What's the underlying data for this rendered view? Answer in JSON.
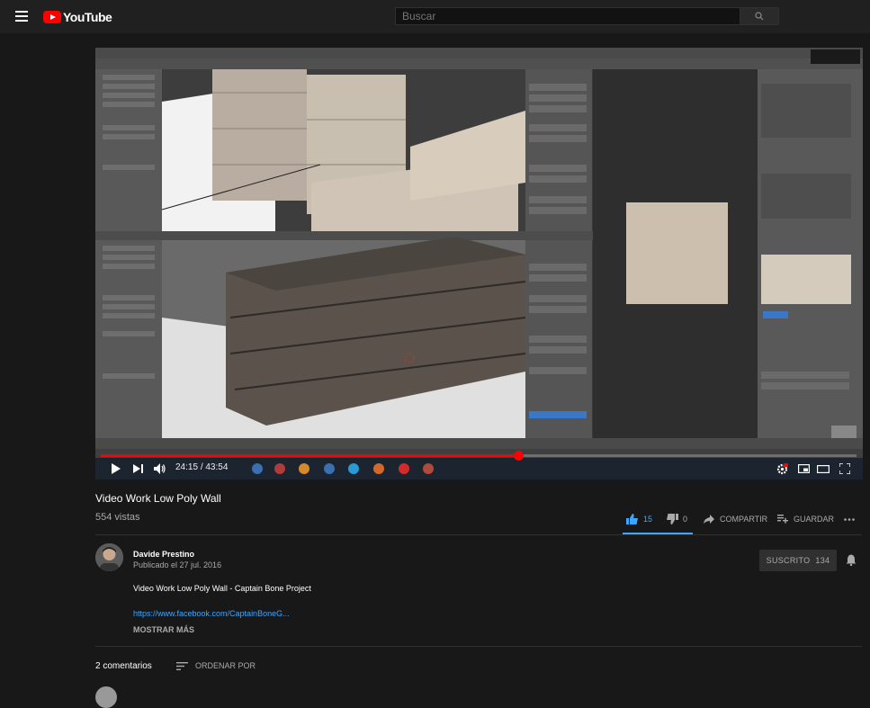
{
  "header": {
    "logo_text": "YouTube",
    "search_placeholder": "Buscar"
  },
  "player": {
    "current_time": "24:15",
    "duration": "43:54",
    "time_separator": "/",
    "progress_fraction": 0.552
  },
  "video": {
    "title": "Video Work Low Poly Wall",
    "views": "554 vistas",
    "likes": "15",
    "dislikes": "0",
    "share_label": "COMPARTIR",
    "save_label": "GUARDAR"
  },
  "channel": {
    "name": "Davide Prestino",
    "published": "Publicado el 27 jul. 2016",
    "subscribe_label": "SUSCRITO",
    "subscriber_count": "134"
  },
  "description": {
    "text": "Video Work Low Poly Wall - Captain Bone Project",
    "link": "https://www.facebook.com/CaptainBoneG...",
    "show_more": "MOSTRAR MÁS"
  },
  "comments": {
    "count_label": "2 comentarios",
    "sort_label": "ORDENAR POR"
  },
  "colors": {
    "accent_blue": "#3ea6ff",
    "brand_red": "#ff0000",
    "background": "#181818"
  }
}
